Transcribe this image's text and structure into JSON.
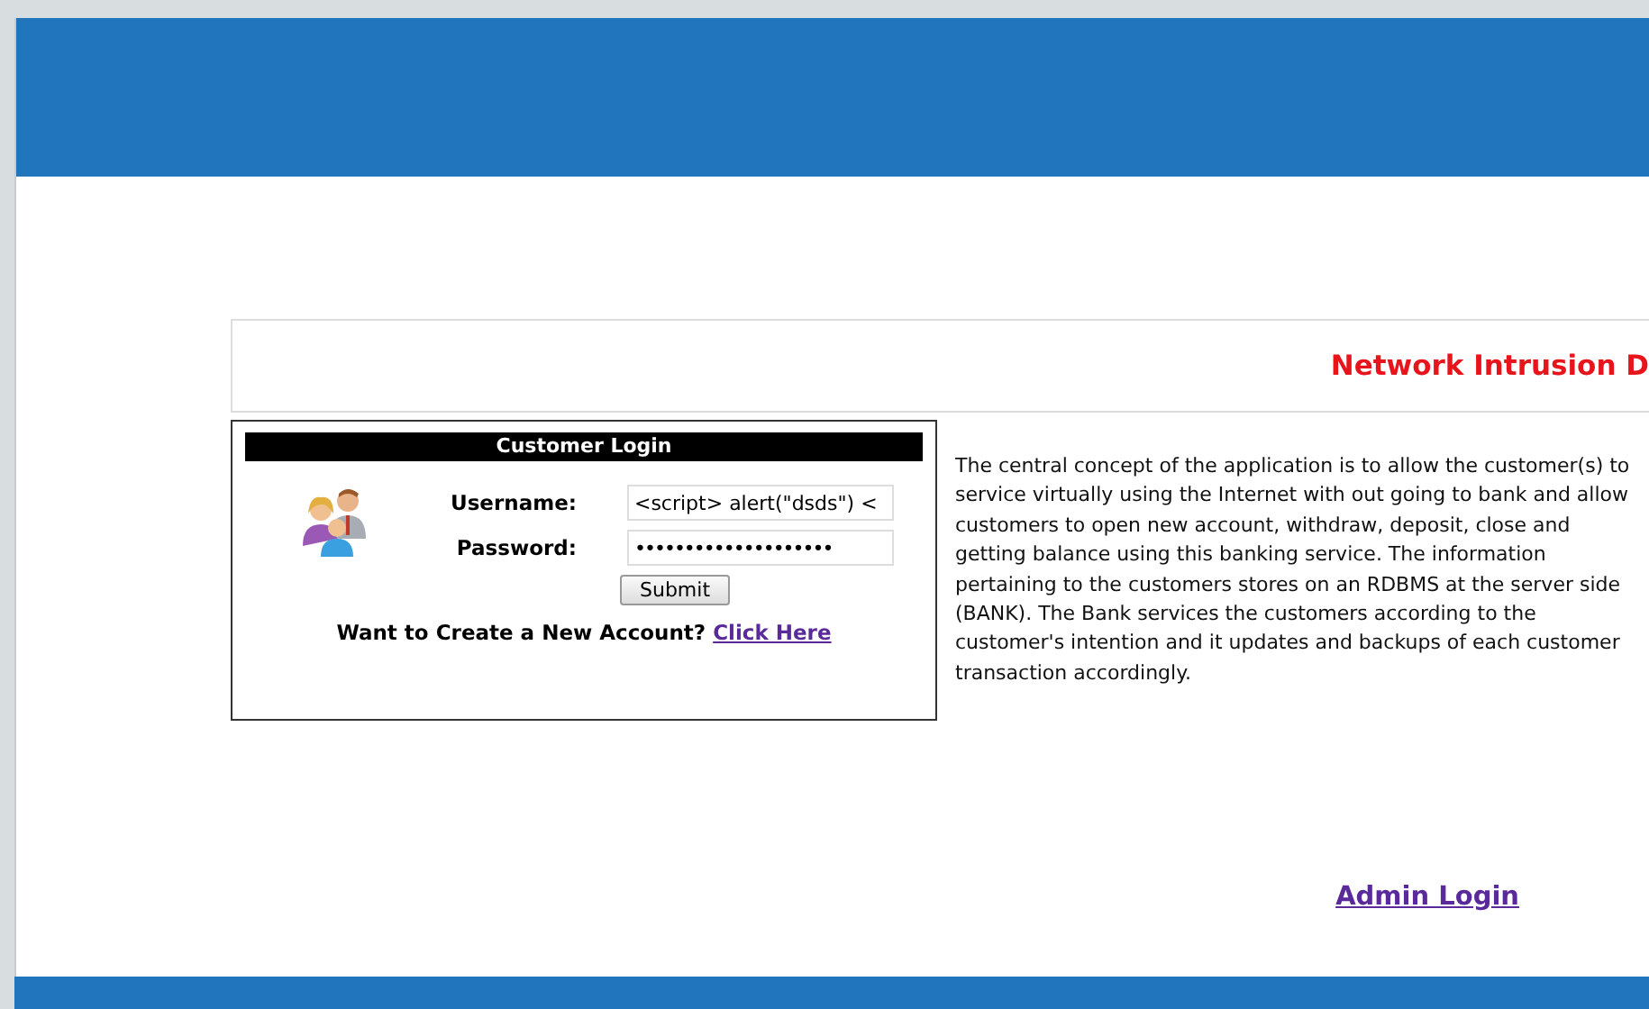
{
  "title": "Network Intrusion D",
  "login": {
    "heading": "Customer Login",
    "fields": [
      {
        "label": "Username:",
        "value": "<script> alert(\"dsds\") <",
        "kind": "text"
      },
      {
        "label": "Password:",
        "value": "••••••••••••••••••••",
        "kind": "password"
      }
    ],
    "submit": "Submit",
    "prompt": "Want to Create a New Account?",
    "link": "Click Here"
  },
  "description": "The central concept of the application is to allow the customer(s) to service virtually using the Internet with out going to bank and allow customers to open new account, withdraw, deposit, close and getting balance using this banking service.  The information pertaining to the customers stores on an RDBMS at the server side (BANK).  The Bank services the customers according to the customer's intention and it updates and backups of each customer transaction accordingly.",
  "admin_link": "Admin Login"
}
